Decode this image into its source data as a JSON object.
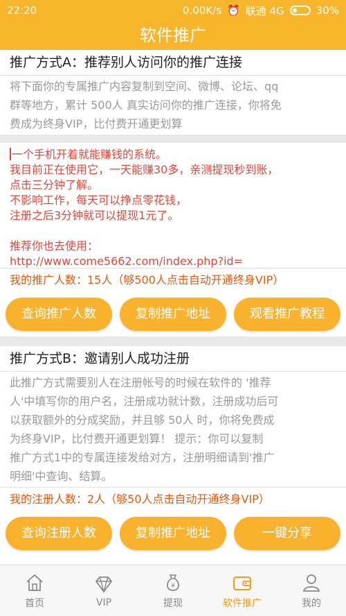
{
  "status": {
    "time": "22:20",
    "speed": "0.00K/s",
    "carrier": "联通 4G",
    "battery": "30%"
  },
  "title": "软件推广",
  "method_a": {
    "title": "推广方式A：推荐别人访问你的推广连接",
    "desc_lines": [
      "将下面你的专属推广内容复制到空间、微博、论坛、qq",
      "群等地方，累计 500人 真实访问你的推广连接，你将免",
      "费成为终身VIP，比付费开通更划算"
    ],
    "promo_lines": [
      "一个手机开着就能赚钱的系统。",
      "我目前正在使用它，一天能赚30多，亲测提现秒到账，",
      "点击三分钟了解。",
      "不影响工作，每天可以挣点零花钱，",
      "注册之后3分钟就可以提现1元了。",
      "",
      "推荐你也去使用：",
      "http://www.come5662.com/index.php?id="
    ],
    "count_text": "我的推广人数：15人（够500人点击自动开通终身VIP）",
    "buttons": [
      "查询推广人数",
      "复制推广地址",
      "观看推广教程"
    ]
  },
  "method_b": {
    "title": "推广方式B：邀请别人成功注册",
    "desc_lines": [
      "此推广方式需要别人在注册帐号的时候在软件的 '推荐",
      "人'中填写你的用户名，注册成功就计数，注册成功后可",
      "以获取额外的分成奖励，并且够 50人 时，你将免费成",
      "为终身VIP，比付费开通更划算！    提示：你可以复制",
      "推广方式1中的专属连接发给对方，注册明细请到'推广",
      "明细'中查询、结算。"
    ],
    "count_text": "我的注册人数：2人（够50人点击自动开通终身VIP）",
    "buttons": [
      "查询注册人数",
      "复制推广地址",
      "一键分享"
    ]
  },
  "tabs": [
    {
      "label": "首页",
      "icon": "home-icon",
      "active": false
    },
    {
      "label": "VIP",
      "icon": "diamond-icon",
      "active": false
    },
    {
      "label": "提现",
      "icon": "money-bag-icon",
      "active": false
    },
    {
      "label": "软件推广",
      "icon": "wallet-icon",
      "active": true
    },
    {
      "label": "我的",
      "icon": "person-icon",
      "active": false
    }
  ],
  "colors": {
    "accent": "#f7b52b",
    "button": "#f9b22e",
    "promo_text": "#e0463c",
    "count_text": "#e05a10",
    "tab_active": "#f29c1f"
  }
}
